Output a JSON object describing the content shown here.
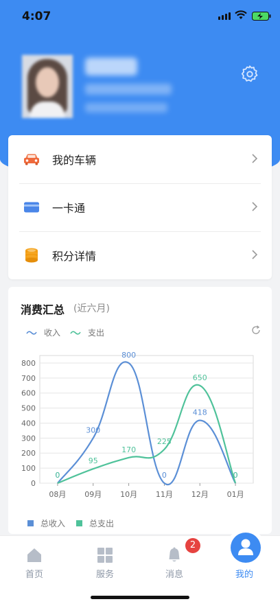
{
  "status_bar": {
    "time": "4:07"
  },
  "menu": [
    {
      "label": "我的车辆",
      "icon": "car-icon"
    },
    {
      "label": "一卡通",
      "icon": "card-icon"
    },
    {
      "label": "积分详情",
      "icon": "coins-icon"
    }
  ],
  "chart_section": {
    "title": "消费汇总",
    "subtitle": "(近六月)",
    "legend_top": [
      "收入",
      "支出"
    ],
    "legend_bottom": [
      "总收入",
      "总支出"
    ]
  },
  "chart_data": {
    "type": "line",
    "categories": [
      "08月",
      "09月",
      "10月",
      "11月",
      "12月",
      "01月"
    ],
    "series": [
      {
        "name": "总收入",
        "values": [
          0,
          300,
          800,
          0,
          418,
          0
        ],
        "color": "#5b8fd6"
      },
      {
        "name": "总支出",
        "values": [
          0,
          95,
          170,
          225,
          650,
          0
        ],
        "color": "#4fc29a"
      }
    ],
    "ylim": [
      0,
      850
    ],
    "yticks": [
      "0",
      "100",
      "200",
      "300",
      "400",
      "500",
      "600",
      "700",
      "800"
    ],
    "grid": true,
    "smooth": true
  },
  "tabbar": {
    "tabs": [
      {
        "label": "首页",
        "icon": "home-icon"
      },
      {
        "label": "服务",
        "icon": "grid-icon"
      },
      {
        "label": "消息",
        "icon": "bell-icon"
      },
      {
        "label": "我的",
        "icon": "user-icon"
      }
    ],
    "badge": "2",
    "active": "我的"
  },
  "colors": {
    "primary": "#3d8bf2",
    "income": "#5b8fd6",
    "expense": "#4fc29a",
    "badge": "#e64340"
  }
}
